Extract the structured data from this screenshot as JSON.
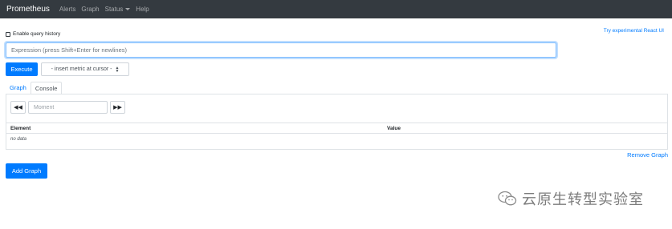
{
  "navbar": {
    "brand": "Prometheus",
    "links": [
      "Alerts",
      "Graph",
      "Status",
      "Help"
    ]
  },
  "history": {
    "label": "Enable query history",
    "checked": false
  },
  "react_link": "Try experimental React UI",
  "expression": {
    "placeholder": "Expression (press Shift+Enter for newlines)",
    "value": ""
  },
  "execute_label": "Execute",
  "metric_select": "- insert metric at cursor -",
  "tabs": [
    "Graph",
    "Console"
  ],
  "console": {
    "prev_glyph": "◀◀",
    "next_glyph": "▶▶",
    "moment_placeholder": "Moment",
    "columns": [
      "Element",
      "Value"
    ],
    "empty_text": "no data"
  },
  "remove_graph": "Remove Graph",
  "add_graph": "Add Graph",
  "watermark": {
    "text": "云原生转型实验室"
  },
  "colors": {
    "navbar_bg": "#343a40",
    "primary": "#007bff",
    "border": "#dee2e6"
  }
}
